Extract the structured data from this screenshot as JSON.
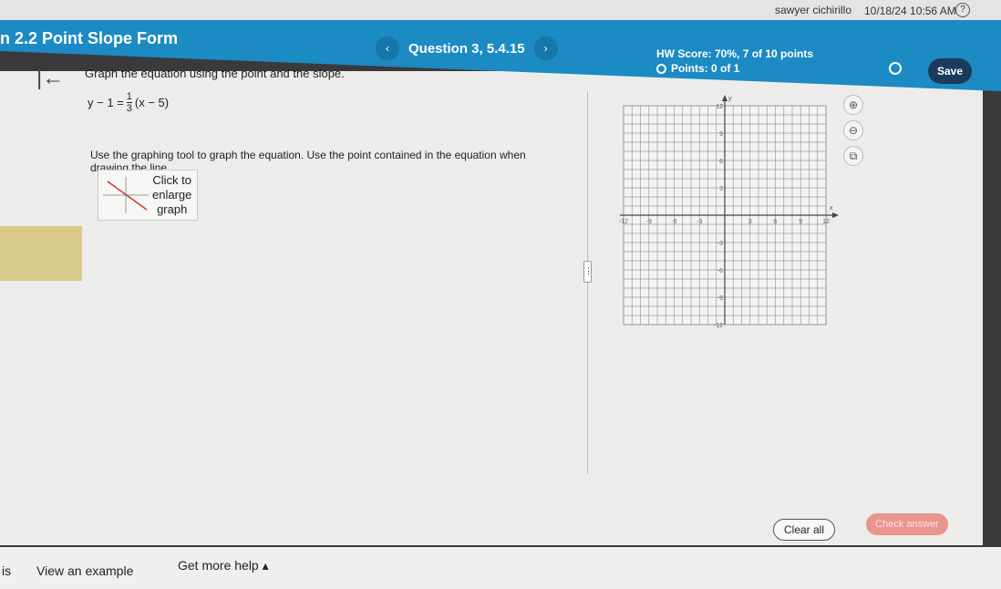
{
  "topbar": {
    "user": "sawyer cichirillo",
    "datetime": "10/18/24 10:56 AM",
    "help_icon": "?"
  },
  "header": {
    "title": "n 2.2 Point Slope Form",
    "question": "Question 3, 5.4.15",
    "prev": "‹",
    "next": "›",
    "hw_score": "HW Score: 70%, 7 of 10 points",
    "points": "Points: 0 of 1",
    "save": "Save"
  },
  "question": {
    "instruction": "Graph the equation using the point and the slope.",
    "eq_left": "y − 1 =",
    "eq_num": "1",
    "eq_den": "3",
    "eq_right": "(x − 5)",
    "use_tool": "Use the graphing tool to graph the equation. Use the point contained in the equation when drawing the line.",
    "thumb_label": [
      "Click to",
      "enlarge",
      "graph"
    ]
  },
  "graph": {
    "xmin": -12,
    "xmax": 12,
    "ymin": -12,
    "ymax": 12,
    "step": 1,
    "tick_labels": [
      -12,
      -9,
      -6,
      -3,
      3,
      6,
      9,
      12
    ],
    "x_label": "x",
    "y_label": "y"
  },
  "tools": {
    "zoom_in": "⊕",
    "zoom_out": "⊖",
    "popout": "⧉"
  },
  "actions": {
    "clear": "Clear all",
    "check": "Check answer"
  },
  "bottom": {
    "left": "is",
    "example": "View an example",
    "help": "Get more help ▴"
  }
}
